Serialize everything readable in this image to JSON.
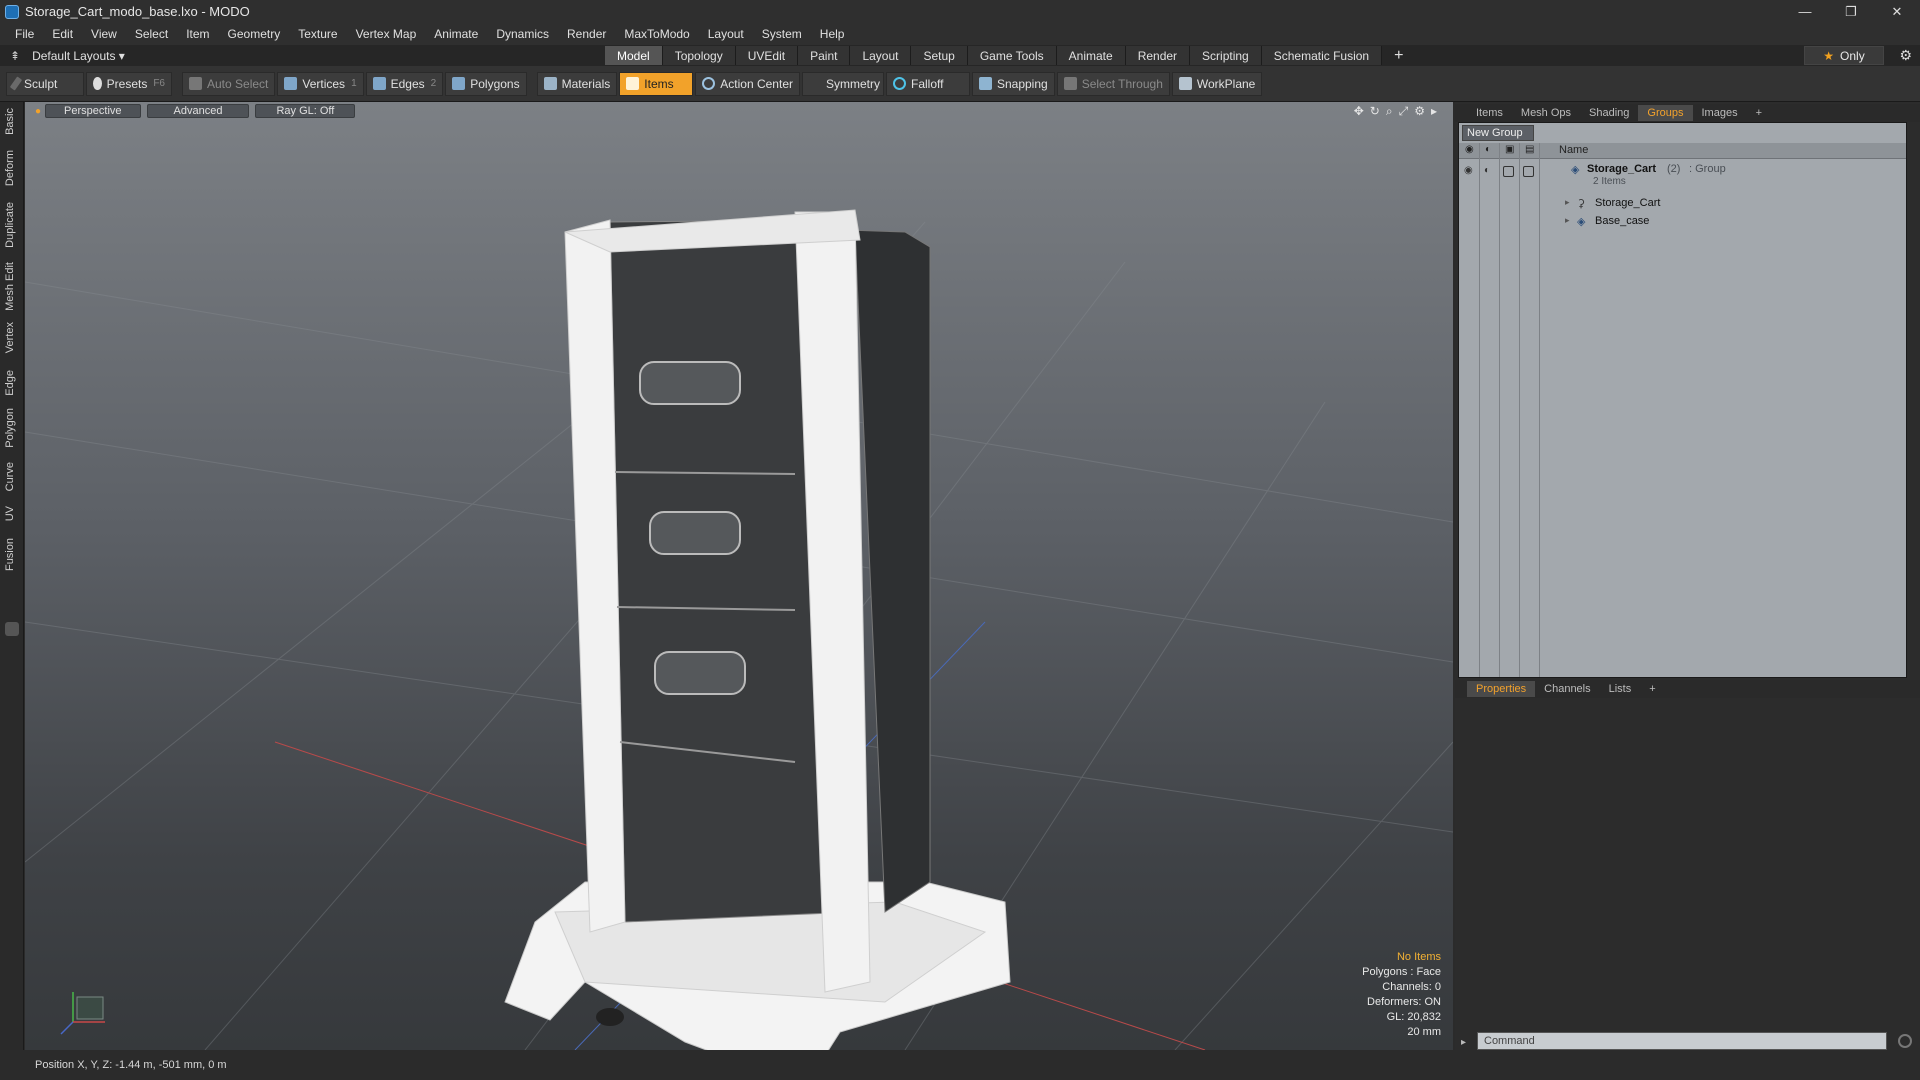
{
  "window": {
    "title": "Storage_Cart_modo_base.lxo - MODO",
    "minimize": "—",
    "restore": "❐",
    "close": "✕"
  },
  "menu": [
    "File",
    "Edit",
    "View",
    "Select",
    "Item",
    "Geometry",
    "Texture",
    "Vertex Map",
    "Animate",
    "Dynamics",
    "Render",
    "MaxToModo",
    "Layout",
    "System",
    "Help"
  ],
  "layout": {
    "preset": "Default Layouts ▾",
    "tabs": [
      "Model",
      "Topology",
      "UVEdit",
      "Paint",
      "Layout",
      "Setup",
      "Game Tools",
      "Animate",
      "Render",
      "Scripting",
      "Schematic Fusion"
    ],
    "active_tab": "Model",
    "add": "+",
    "only_label": "Only"
  },
  "toolbar": {
    "sculpt": "Sculpt",
    "presets": "Presets",
    "presets_key": "F6",
    "auto_select": "Auto Select",
    "vertices": "Vertices",
    "vertices_key": "1",
    "edges": "Edges",
    "edges_key": "2",
    "polygons": "Polygons",
    "materials": "Materials",
    "items": "Items",
    "action_center": "Action Center",
    "symmetry": "Symmetry",
    "falloff": "Falloff",
    "snapping": "Snapping",
    "select_through": "Select Through",
    "workplane": "WorkPlane"
  },
  "left_tabs": [
    "Basic",
    "Deform",
    "Duplicate",
    "Mesh Edit",
    "Vertex",
    "Edge",
    "Polygon",
    "Curve",
    "UV",
    "Fusion"
  ],
  "viewport": {
    "view": "Perspective",
    "shading": "Advanced",
    "raygl": "Ray GL: Off",
    "hud": {
      "selection": "No Items",
      "polygons": "Polygons : Face",
      "channels": "Channels: 0",
      "deformers": "Deformers: ON",
      "gl": "GL: 20,832",
      "scale": "20 mm"
    }
  },
  "panel_tabs": [
    "Items",
    "Mesh Ops",
    "Shading",
    "Groups",
    "Images"
  ],
  "panel_active": "Groups",
  "groups": {
    "new_group": "New Group",
    "name_header": "Name",
    "rows": [
      {
        "name": "Storage_Cart",
        "count": "(2)",
        "type": ": Group",
        "sub": "2 Items"
      },
      {
        "name": "Storage_Cart"
      },
      {
        "name": "Base_case"
      }
    ]
  },
  "props_tabs": [
    "Properties",
    "Channels",
    "Lists"
  ],
  "props_active": "Properties",
  "command_placeholder": "Command",
  "status": {
    "position": "Position X, Y, Z:  -1.44 m, -501 mm, 0 m"
  },
  "colors": {
    "accent": "#f2a22a",
    "viewport_top": "#7c8085",
    "groups_bg": "#a3a8ad"
  }
}
